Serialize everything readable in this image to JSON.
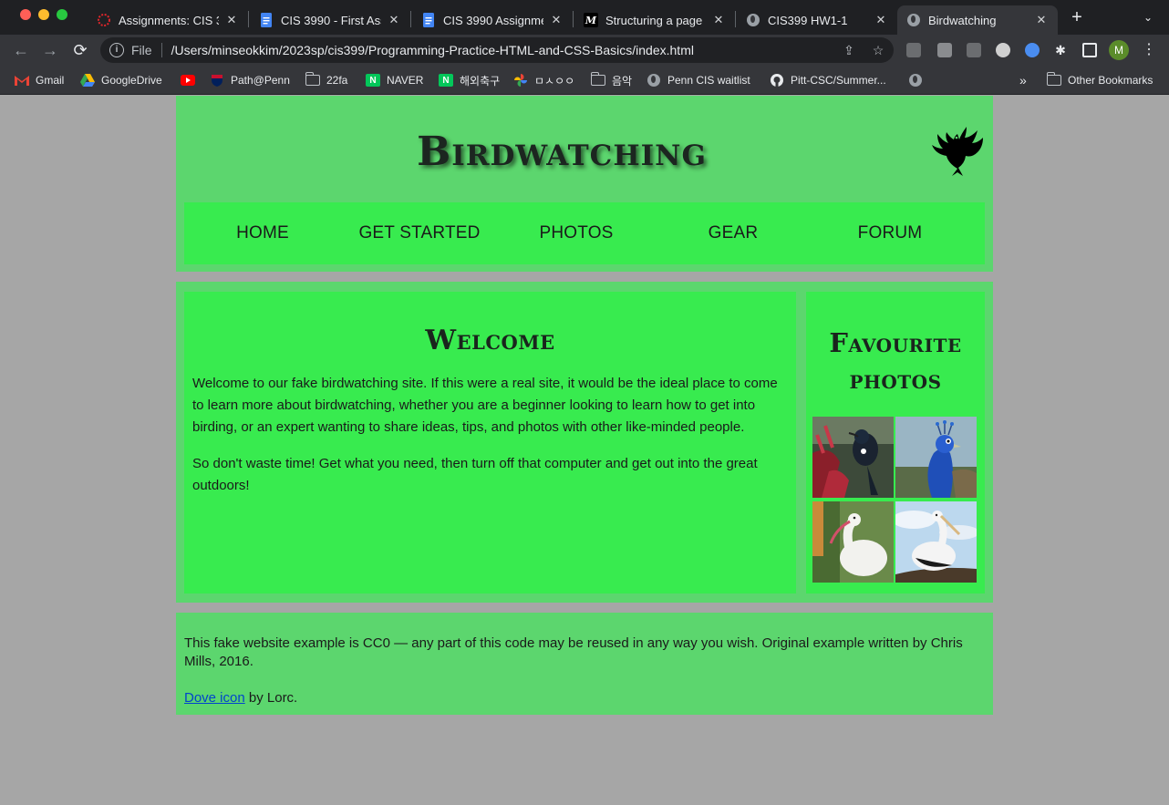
{
  "browser": {
    "tabs": [
      {
        "title": "Assignments: CIS 39",
        "icon": "canvas-icon",
        "active": false
      },
      {
        "title": "CIS 3990 - First Ass",
        "icon": "google-docs-icon",
        "active": false
      },
      {
        "title": "CIS 3990 Assignme",
        "icon": "google-docs-icon",
        "active": false
      },
      {
        "title": "Structuring a page c",
        "icon": "mdn-icon",
        "active": false
      },
      {
        "title": "CIS399 HW1-1",
        "icon": "globe-icon",
        "active": false
      },
      {
        "title": "Birdwatching",
        "icon": "globe-icon",
        "active": true
      }
    ],
    "new_tab": "+",
    "address": {
      "scheme_label": "File",
      "url": "/Users/minseokkim/2023sp/cis399/Programming-Practice-HTML-and-CSS-Basics/index.html"
    },
    "profile_initial": "M",
    "bookmarks": [
      {
        "label": "Gmail",
        "icon": "gmail-icon"
      },
      {
        "label": "GoogleDrive",
        "icon": "google-drive-icon"
      },
      {
        "label": "",
        "icon": "youtube-icon"
      },
      {
        "label": "Path@Penn",
        "icon": "penn-shield-icon"
      },
      {
        "label": "22fa",
        "icon": "folder-icon"
      },
      {
        "label": "NAVER",
        "icon": "naver-icon"
      },
      {
        "label": "해외축구",
        "icon": "naver-icon"
      },
      {
        "label": "ㅁㅅㅇㅇ",
        "icon": "google-photos-icon"
      },
      {
        "label": "음악",
        "icon": "folder-icon"
      },
      {
        "label": "Penn CIS waitlist",
        "icon": "globe-icon"
      },
      {
        "label": "Pitt-CSC/Summer...",
        "icon": "github-icon"
      },
      {
        "label": "",
        "icon": "globe-icon"
      }
    ],
    "bookmarks_overflow": "»",
    "other_bookmarks": "Other Bookmarks"
  },
  "site": {
    "title": "Birdwatching",
    "nav": [
      "HOME",
      "GET STARTED",
      "PHOTOS",
      "GEAR",
      "FORUM"
    ],
    "main": {
      "heading": "Welcome",
      "paragraphs": [
        "Welcome to our fake birdwatching site. If this were a real site, it would be the ideal place to come to learn more about birdwatching, whether you are a beginner looking to learn how to get into birding, or an expert wanting to share ideas, tips, and photos with other like-minded people.",
        "So don't waste time! Get what you need, then turn off that computer and get out into the great outdoors!"
      ]
    },
    "aside": {
      "heading_line1": "Favourite",
      "heading_line2": "photos",
      "photos": [
        "tui-bird-photo",
        "peacock-photo",
        "white-ibis-photo",
        "stork-photo"
      ]
    },
    "footer": {
      "license": "This fake website example is CC0 — any part of this code may be reused in any way you wish. Original example written by Chris Mills, 2016.",
      "credit_link": "Dove icon",
      "credit_rest": " by Lorc."
    }
  },
  "colors": {
    "page_bg": "#a6a6a6",
    "panel_green": "#5cd66e",
    "bright_green": "#38eb4f",
    "link_blue": "#0044cc"
  }
}
